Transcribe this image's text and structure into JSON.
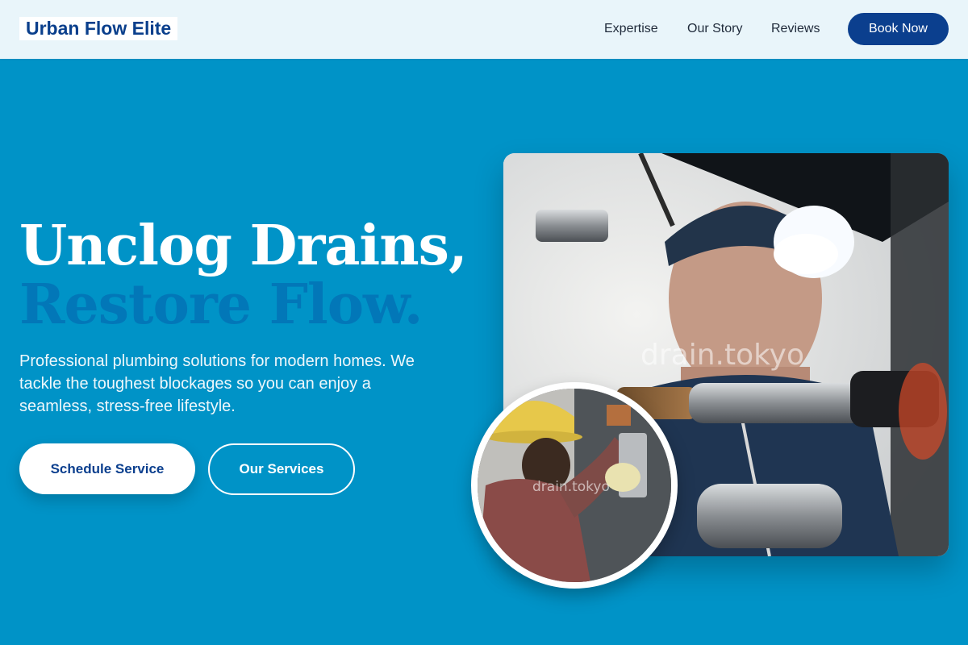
{
  "header": {
    "brand": "Urban Flow Elite",
    "nav": [
      {
        "label": "Expertise"
      },
      {
        "label": "Our Story"
      },
      {
        "label": "Reviews"
      }
    ],
    "cta_label": "Book Now"
  },
  "hero": {
    "headline_line1": "Unclog Drains,",
    "headline_line2": "Restore Flow.",
    "description": "Professional plumbing solutions for modern homes. We tackle the toughest blockages so you can enjoy a seamless, stress-free lifestyle.",
    "primary_button": "Schedule Service",
    "secondary_button": "Our Services"
  },
  "images": {
    "main_watermark": "drain.tokyo",
    "inset_watermark": "drain.tokyo"
  },
  "colors": {
    "background": "#0093c7",
    "navbar_bg": "#e9f5fa",
    "brand_text": "#0a3f8c",
    "accent_dark": "#0b3f8e",
    "headline_accent": "#0277b8"
  }
}
